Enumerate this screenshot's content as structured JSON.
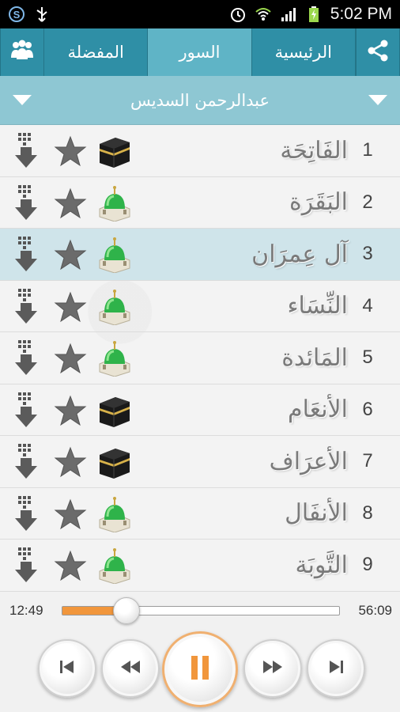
{
  "status_bar": {
    "time": "5:02 PM",
    "left_icons": [
      "skype-icon",
      "usb-icon"
    ],
    "right_icons": [
      "alarm-icon",
      "wifi-icon",
      "signal-icon",
      "battery-charging-icon"
    ]
  },
  "tabs": {
    "share_icon": "share-icon",
    "home": "الرئيسية",
    "surahs": "السور",
    "favorites": "المفضلة",
    "people_icon": "people-icon",
    "active": "surahs"
  },
  "reciter": {
    "name": "عبدالرحمن السديس"
  },
  "surahs": [
    {
      "number": "1",
      "name": "الفَاتِحَة",
      "place": "mecca"
    },
    {
      "number": "2",
      "name": "البَقَرَة",
      "place": "medina"
    },
    {
      "number": "3",
      "name": "آل عِمرَان",
      "place": "medina",
      "selected": true
    },
    {
      "number": "4",
      "name": "النِّسَاء",
      "place": "medina"
    },
    {
      "number": "5",
      "name": "المَائدة",
      "place": "medina"
    },
    {
      "number": "6",
      "name": "الأنعَام",
      "place": "mecca"
    },
    {
      "number": "7",
      "name": "الأعرَاف",
      "place": "mecca"
    },
    {
      "number": "8",
      "name": "الأنفَال",
      "place": "medina"
    },
    {
      "number": "9",
      "name": "التَّوبَة",
      "place": "medina"
    }
  ],
  "player": {
    "elapsed": "12:49",
    "total": "56:09",
    "progress_fraction": 0.23,
    "accent": "#f1963c"
  },
  "colors": {
    "tabbar": "#2f8fa6",
    "tab_active": "#5fb4c6",
    "reciter_bar": "#8ec7d3",
    "selected_row": "#cfe4ea"
  }
}
